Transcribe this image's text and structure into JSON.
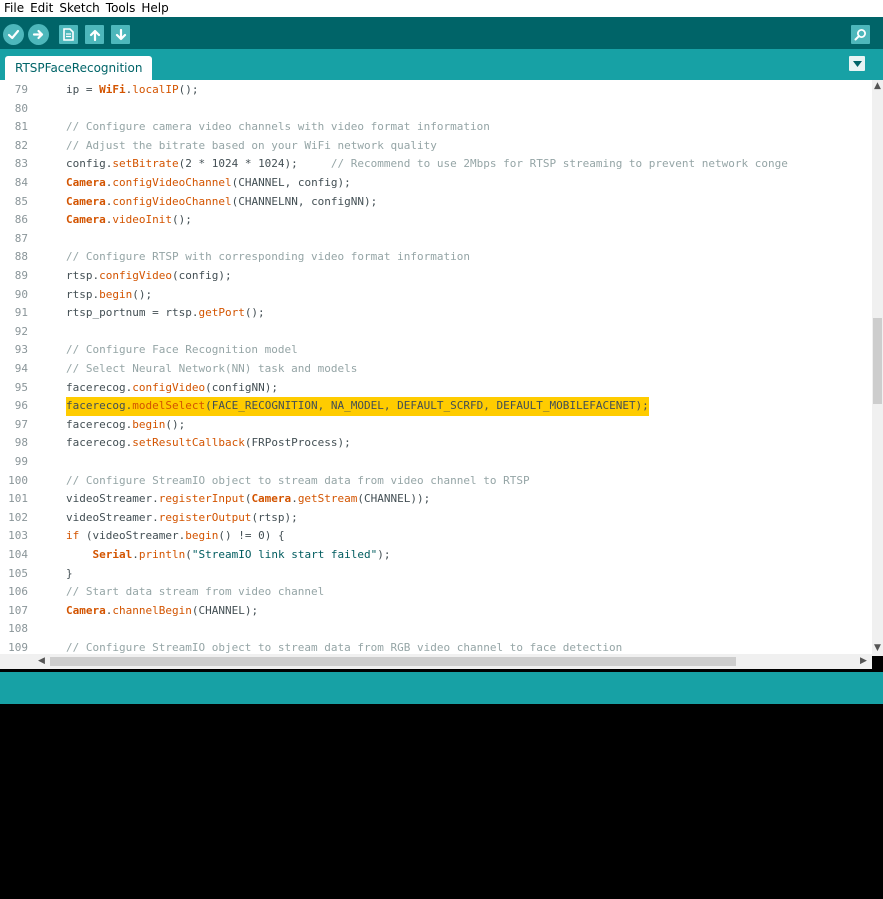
{
  "menu": [
    "File",
    "Edit",
    "Sketch",
    "Tools",
    "Help"
  ],
  "toolbar": {
    "buttons": [
      {
        "name": "verify-button",
        "icon": "check-icon"
      },
      {
        "name": "upload-button",
        "icon": "arrow-right-icon"
      },
      {
        "name": "new-button",
        "icon": "new-file-icon"
      },
      {
        "name": "open-button",
        "icon": "arrow-up-icon"
      },
      {
        "name": "save-button",
        "icon": "arrow-down-icon"
      }
    ],
    "serial_monitor_icon": "magnifier-icon"
  },
  "tab": {
    "label": "RTSPFaceRecognition"
  },
  "colors": {
    "toolbar": "#006468",
    "tabbar": "#17a1a5",
    "highlight": "#ffcc00",
    "keyword": "#d35400",
    "comment": "#95a5a6"
  },
  "editor": {
    "highlighted_line": "96",
    "lines": [
      {
        "n": "79",
        "t": "ip = WiFi.localIP();"
      },
      {
        "n": "80",
        "t": ""
      },
      {
        "n": "81",
        "t": "// Configure camera video channels with video format information"
      },
      {
        "n": "82",
        "t": "// Adjust the bitrate based on your WiFi network quality"
      },
      {
        "n": "83",
        "t": "config.setBitrate(2 * 1024 * 1024);     // Recommend to use 2Mbps for RTSP streaming to prevent network conge"
      },
      {
        "n": "84",
        "t": "Camera.configVideoChannel(CHANNEL, config);"
      },
      {
        "n": "85",
        "t": "Camera.configVideoChannel(CHANNELNN, configNN);"
      },
      {
        "n": "86",
        "t": "Camera.videoInit();"
      },
      {
        "n": "87",
        "t": ""
      },
      {
        "n": "88",
        "t": "// Configure RTSP with corresponding video format information"
      },
      {
        "n": "89",
        "t": "rtsp.configVideo(config);"
      },
      {
        "n": "90",
        "t": "rtsp.begin();"
      },
      {
        "n": "91",
        "t": "rtsp_portnum = rtsp.getPort();"
      },
      {
        "n": "92",
        "t": ""
      },
      {
        "n": "93",
        "t": "// Configure Face Recognition model"
      },
      {
        "n": "94",
        "t": "// Select Neural Network(NN) task and models"
      },
      {
        "n": "95",
        "t": "facerecog.configVideo(configNN);"
      },
      {
        "n": "96",
        "t": "facerecog.modelSelect(FACE_RECOGNITION, NA_MODEL, DEFAULT_SCRFD, DEFAULT_MOBILEFACENET);"
      },
      {
        "n": "97",
        "t": "facerecog.begin();"
      },
      {
        "n": "98",
        "t": "facerecog.setResultCallback(FRPostProcess);"
      },
      {
        "n": "99",
        "t": ""
      },
      {
        "n": "100",
        "t": "// Configure StreamIO object to stream data from video channel to RTSP"
      },
      {
        "n": "101",
        "t": "videoStreamer.registerInput(Camera.getStream(CHANNEL));"
      },
      {
        "n": "102",
        "t": "videoStreamer.registerOutput(rtsp);"
      },
      {
        "n": "103",
        "t": "if (videoStreamer.begin() != 0) {"
      },
      {
        "n": "104",
        "t": "    Serial.println(\"StreamIO link start failed\");"
      },
      {
        "n": "105",
        "t": "}"
      },
      {
        "n": "106",
        "t": "// Start data stream from video channel"
      },
      {
        "n": "107",
        "t": "Camera.channelBegin(CHANNEL);"
      },
      {
        "n": "108",
        "t": ""
      },
      {
        "n": "109",
        "t": "// Configure StreamIO object to stream data from RGB video channel to face detection"
      }
    ]
  }
}
